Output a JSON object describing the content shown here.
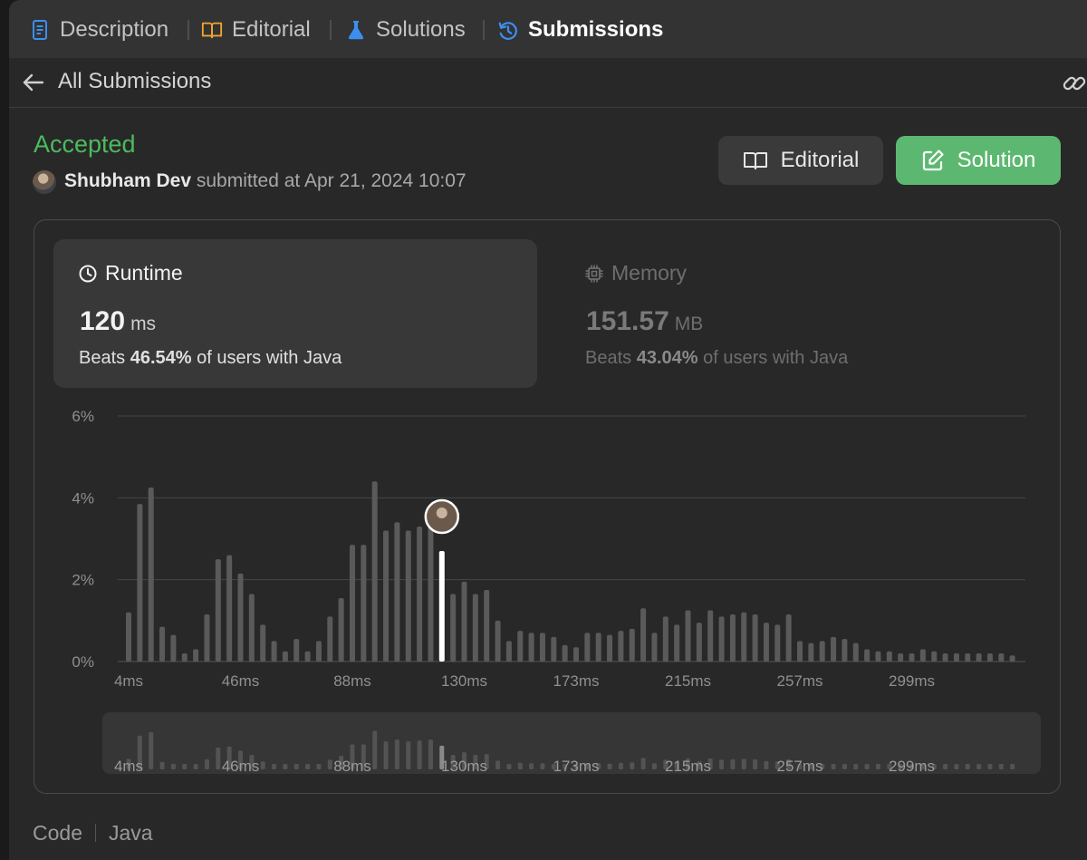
{
  "tabs": [
    {
      "label": "Description",
      "icon": "description-icon",
      "active": false
    },
    {
      "label": "Editorial",
      "icon": "book-icon",
      "active": false
    },
    {
      "label": "Solutions",
      "icon": "flask-icon",
      "active": false
    },
    {
      "label": "Submissions",
      "icon": "history-icon",
      "active": true
    }
  ],
  "subheader": {
    "title": "All Submissions"
  },
  "submission": {
    "status": "Accepted",
    "user": "Shubham Dev",
    "submitted_text": "submitted at Apr 21, 2024 10:07"
  },
  "buttons": {
    "editorial": "Editorial",
    "solution": "Solution"
  },
  "runtime": {
    "title": "Runtime",
    "value": "120",
    "unit": "ms",
    "beats_prefix": "Beats",
    "beats_value": "46.54%",
    "beats_suffix": "of users with Java"
  },
  "memory": {
    "title": "Memory",
    "value": "151.57",
    "unit": "MB",
    "beats_prefix": "Beats",
    "beats_value": "43.04%",
    "beats_suffix": "of users with Java"
  },
  "chart_data": {
    "type": "bar",
    "ylim": [
      0,
      6
    ],
    "y_ticks": [
      "0%",
      "2%",
      "4%",
      "6%"
    ],
    "x_tick_labels": [
      "4ms",
      "46ms",
      "88ms",
      "130ms",
      "173ms",
      "215ms",
      "257ms",
      "299ms"
    ],
    "highlight_label": "120ms",
    "highlight_index": 28,
    "values": [
      1.2,
      3.85,
      4.25,
      0.85,
      0.65,
      0.2,
      0.3,
      1.15,
      2.5,
      2.6,
      2.15,
      1.65,
      0.9,
      0.5,
      0.25,
      0.55,
      0.25,
      0.5,
      1.1,
      1.55,
      2.85,
      2.85,
      4.4,
      3.2,
      3.4,
      3.2,
      3.3,
      3.4,
      2.7,
      1.65,
      1.95,
      1.65,
      1.75,
      1.0,
      0.5,
      0.75,
      0.7,
      0.7,
      0.6,
      0.4,
      0.35,
      0.7,
      0.7,
      0.65,
      0.75,
      0.8,
      1.3,
      0.7,
      1.1,
      0.9,
      1.25,
      0.95,
      1.25,
      1.1,
      1.15,
      1.2,
      1.15,
      0.95,
      0.9,
      1.15,
      0.5,
      0.45,
      0.5,
      0.6,
      0.55,
      0.45,
      0.3,
      0.25,
      0.25,
      0.2,
      0.2,
      0.3,
      0.25,
      0.2,
      0.2,
      0.2,
      0.2,
      0.2,
      0.2,
      0.15
    ]
  },
  "code_section": {
    "label": "Code",
    "language": "Java"
  },
  "colors": {
    "accepted": "#4cbb5e",
    "solution_button": "#5cb870",
    "active_tab_icon": "#3b8ff0",
    "editorial_tab_icon": "#f0a530",
    "solutions_tab_icon": "#3b8ff0"
  }
}
